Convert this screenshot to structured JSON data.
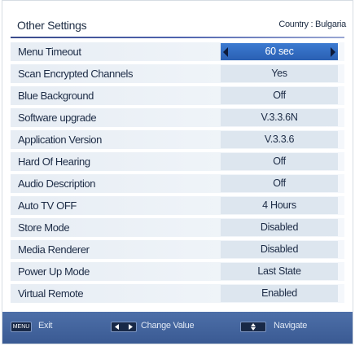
{
  "header": {
    "title": "Other Settings",
    "country": "Country : Bulgaria"
  },
  "settings": [
    {
      "label": "Menu Timeout",
      "value": "60 sec",
      "selected": true
    },
    {
      "label": "Scan Encrypted Channels",
      "value": "Yes"
    },
    {
      "label": "Blue Background",
      "value": "Off"
    },
    {
      "label": "Software upgrade",
      "value": "V.3.3.6N"
    },
    {
      "label": "Application Version",
      "value": "V.3.3.6"
    },
    {
      "label": "Hard Of Hearing",
      "value": "Off"
    },
    {
      "label": "Audio Description",
      "value": "Off"
    },
    {
      "label": "Auto TV OFF",
      "value": "4 Hours"
    },
    {
      "label": "Store Mode",
      "value": "Disabled"
    },
    {
      "label": "Media Renderer",
      "value": "Disabled"
    },
    {
      "label": "Power Up Mode",
      "value": "Last State"
    },
    {
      "label": "Virtual Remote",
      "value": "Enabled"
    }
  ],
  "footer": {
    "menu_key": "MENU",
    "exit_label": "Exit",
    "change_value_label": "Change Value",
    "navigate_label": "Navigate"
  },
  "colors": {
    "selected": "#2f68bd",
    "footer": "#4464a0",
    "accent_line": "#4f64ae"
  }
}
